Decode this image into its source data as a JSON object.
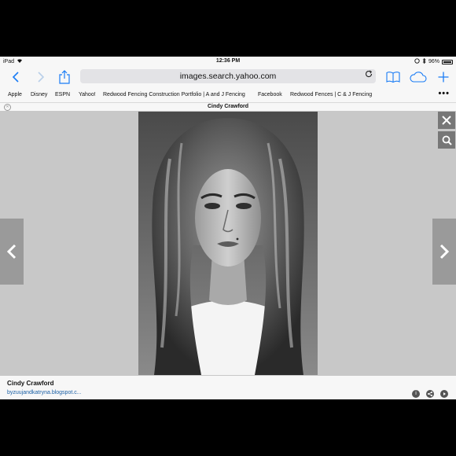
{
  "status_bar": {
    "device": "iPad",
    "time": "12:36 PM",
    "battery": "96%"
  },
  "toolbar": {
    "url": "images.search.yahoo.com"
  },
  "bookmarks": [
    "Apple",
    "Disney",
    "ESPN",
    "Yahoo!",
    "Redwood Fencing Construction Portfolio | A and J Fencing",
    "Facebook",
    "Redwood Fences | C & J Fencing"
  ],
  "page": {
    "title": "Cindy Crawford"
  },
  "caption": {
    "title": "Cindy Crawford",
    "source": "byzuujandkatryna.blogspot.c..."
  },
  "colors": {
    "accent": "#1a7cf5",
    "viewer_bg": "#c8c8c8",
    "chrome_bg": "#f7f7f7"
  }
}
